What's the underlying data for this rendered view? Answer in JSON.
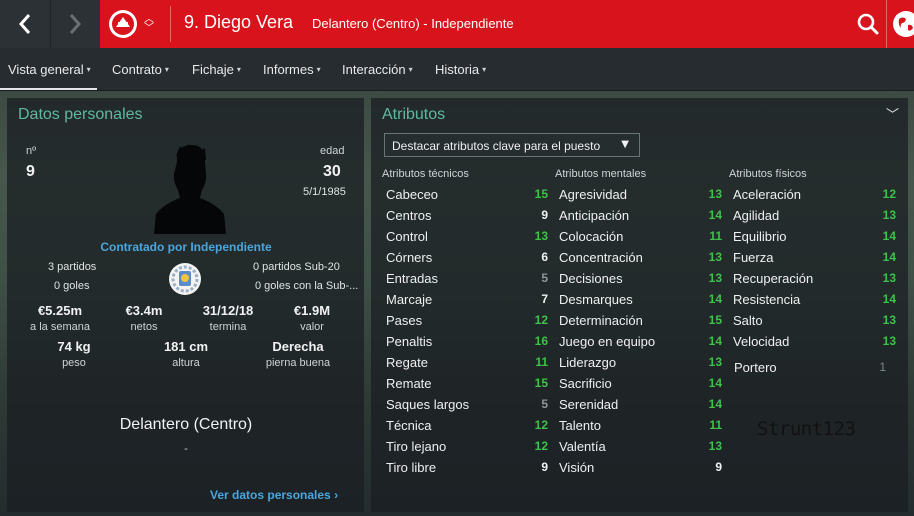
{
  "header": {
    "player_name": "9. Diego Vera",
    "position_club": "Delantero (Centro) - Independiente"
  },
  "tabs": [
    {
      "label": "Vista general"
    },
    {
      "label": "Contrato"
    },
    {
      "label": "Fichaje"
    },
    {
      "label": "Informes"
    },
    {
      "label": "Interacción"
    },
    {
      "label": "Historia"
    }
  ],
  "personal": {
    "title": "Datos personales",
    "number_label": "nº",
    "number": "9",
    "age_label": "edad",
    "age": "30",
    "dob": "5/1/1985",
    "contract_text": "Contratado por Independiente",
    "matches": "3 partidos",
    "goals": "0 goles",
    "u20_matches": "0 partidos Sub-20",
    "u20_goals": "0 goles con la Sub-...",
    "stats": [
      {
        "value": "€5.25m",
        "label": "a la semana"
      },
      {
        "value": "€3.4m",
        "label": "netos"
      },
      {
        "value": "31/12/18",
        "label": "termina"
      },
      {
        "value": "€1.9M",
        "label": "valor"
      }
    ],
    "physical": [
      {
        "value": "74 kg",
        "label": "peso"
      },
      {
        "value": "181 cm",
        "label": "altura"
      },
      {
        "value": "Derecha",
        "label": "pierna buena"
      }
    ],
    "position": "Delantero (Centro)",
    "position_sub": "-",
    "link": "Ver datos personales"
  },
  "attributes": {
    "title": "Atributos",
    "dropdown": "Destacar atributos clave para el puesto",
    "columns": [
      {
        "header": "Atributos técnicos",
        "items": [
          {
            "name": "Cabeceo",
            "value": "15"
          },
          {
            "name": "Centros",
            "value": "9"
          },
          {
            "name": "Control",
            "value": "13"
          },
          {
            "name": "Córners",
            "value": "6"
          },
          {
            "name": "Entradas",
            "value": "5"
          },
          {
            "name": "Marcaje",
            "value": "7"
          },
          {
            "name": "Pases",
            "value": "12"
          },
          {
            "name": "Penaltis",
            "value": "16"
          },
          {
            "name": "Regate",
            "value": "11"
          },
          {
            "name": "Remate",
            "value": "15"
          },
          {
            "name": "Saques largos",
            "value": "5"
          },
          {
            "name": "Técnica",
            "value": "12"
          },
          {
            "name": "Tiro lejano",
            "value": "12"
          },
          {
            "name": "Tiro libre",
            "value": "9"
          }
        ]
      },
      {
        "header": "Atributos mentales",
        "items": [
          {
            "name": "Agresividad",
            "value": "13"
          },
          {
            "name": "Anticipación",
            "value": "14"
          },
          {
            "name": "Colocación",
            "value": "11"
          },
          {
            "name": "Concentración",
            "value": "13"
          },
          {
            "name": "Decisiones",
            "value": "13"
          },
          {
            "name": "Desmarques",
            "value": "14"
          },
          {
            "name": "Determinación",
            "value": "15"
          },
          {
            "name": "Juego en equipo",
            "value": "14"
          },
          {
            "name": "Liderazgo",
            "value": "13"
          },
          {
            "name": "Sacrificio",
            "value": "14"
          },
          {
            "name": "Serenidad",
            "value": "14"
          },
          {
            "name": "Talento",
            "value": "11"
          },
          {
            "name": "Valentía",
            "value": "13"
          },
          {
            "name": "Visión",
            "value": "9"
          }
        ]
      },
      {
        "header": "Atributos físicos",
        "items": [
          {
            "name": "Aceleración",
            "value": "12"
          },
          {
            "name": "Agilidad",
            "value": "13"
          },
          {
            "name": "Equilibrio",
            "value": "14"
          },
          {
            "name": "Fuerza",
            "value": "14"
          },
          {
            "name": "Recuperación",
            "value": "13"
          },
          {
            "name": "Resistencia",
            "value": "14"
          },
          {
            "name": "Salto",
            "value": "13"
          },
          {
            "name": "Velocidad",
            "value": "13"
          }
        ]
      }
    ],
    "goalkeeper": {
      "name": "Portero",
      "value": "1"
    }
  },
  "watermark": "Strunt123",
  "colors": {
    "accent_red": "#d8131c",
    "title_teal": "#5fb9a0",
    "link_blue": "#4aa6dc",
    "val_green": "#3ec24a",
    "val_white": "#f0f2f3",
    "val_grey": "#8f969a"
  }
}
